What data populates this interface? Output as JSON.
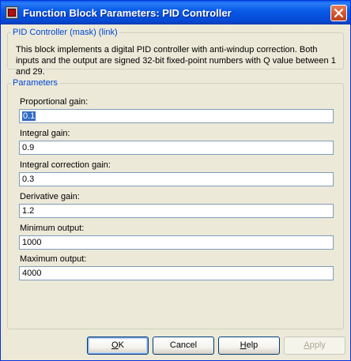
{
  "window": {
    "title": "Function Block Parameters: PID Controller"
  },
  "description_group": {
    "legend": "PID Controller (mask) (link)",
    "text": "This block implements a digital PID controller with anti-windup correction. Both inputs and the output are signed 32-bit fixed-point numbers with Q value between 1 and 29."
  },
  "parameters_group": {
    "legend": "Parameters",
    "fields": [
      {
        "label": "Proportional gain:",
        "value": "0.1",
        "selected": true
      },
      {
        "label": "Integral gain:",
        "value": "0.9"
      },
      {
        "label": "Integral correction gain:",
        "value": "0.3"
      },
      {
        "label": "Derivative gain:",
        "value": "1.2"
      },
      {
        "label": "Minimum output:",
        "value": "1000"
      },
      {
        "label": "Maximum output:",
        "value": "4000"
      }
    ]
  },
  "buttons": {
    "ok": {
      "accel": "O",
      "rest": "K",
      "enabled": true
    },
    "cancel": {
      "label": "Cancel",
      "enabled": true
    },
    "help": {
      "accel": "H",
      "rest": "elp",
      "enabled": true
    },
    "apply": {
      "accel": "A",
      "rest": "pply",
      "enabled": false
    }
  },
  "icons": {
    "app": "simulink-block-icon",
    "close": "close-icon"
  }
}
